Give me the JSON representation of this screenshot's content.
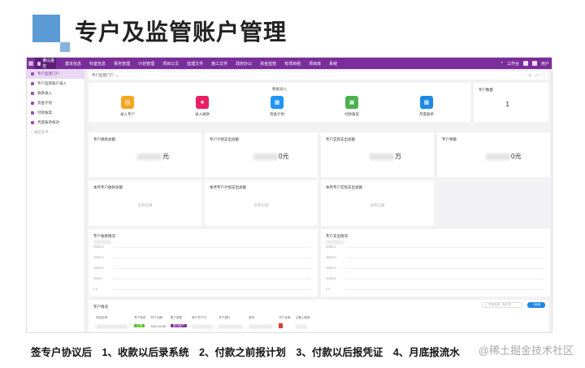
{
  "slide": {
    "title": "专户及监管账户管理",
    "caption": "签专户协议后　1、收款以后录系统　2、付款之前报计划　3、付款以后报凭证　4、月底报流水",
    "watermark": "@稀土掘金技术社区"
  },
  "app": {
    "logo_text": "佛山金控",
    "nav": [
      "基本信息",
      "科室信息",
      "事务管理",
      "计划管理",
      "项目公文",
      "监理文件",
      "施工文件",
      "政府办公",
      "资金监管",
      "有项目组",
      "项目库",
      "系统"
    ],
    "nav_right": {
      "workbench": "工作台",
      "user": "用户"
    },
    "sidebar": [
      {
        "label": "专户监管门户",
        "active": true
      },
      {
        "label": "专户监管账户录入",
        "active": false
      },
      {
        "label": "收款录入",
        "active": false
      },
      {
        "label": "资金计划",
        "active": false
      },
      {
        "label": "付款备案",
        "active": false
      },
      {
        "label": "月度账单核对",
        "active": false
      }
    ],
    "sidebar_collapse": "« 收起菜单",
    "tab": {
      "label": "专户监管门户",
      "close": "×"
    },
    "quick": {
      "caption": "数据录入",
      "items": [
        {
          "label": "录入专户",
          "icon": "book-icon",
          "color": "#f5a623",
          "glyph": "▤"
        },
        {
          "label": "录入收款",
          "icon": "star-icon",
          "color": "#e91e63",
          "glyph": "★"
        },
        {
          "label": "资金计划",
          "icon": "doc-icon",
          "color": "#2196f3",
          "glyph": "▦"
        },
        {
          "label": "付款备案",
          "icon": "image-icon",
          "color": "#4caf50",
          "glyph": "▣"
        },
        {
          "label": "月度账单",
          "icon": "calendar-icon",
          "color": "#1e88e5",
          "glyph": "▦"
        }
      ]
    },
    "account_count": {
      "title": "专户数量",
      "value": "1"
    },
    "stats": [
      {
        "title": "专户收款总额",
        "suffix": "元"
      },
      {
        "title": "专户计划支出总额",
        "suffix": "0元"
      },
      {
        "title": "专户实际支出总额",
        "suffix": "万"
      },
      {
        "title": "专户余额",
        "suffix": "0元"
      }
    ],
    "monthly": [
      {
        "title": "本月专户收款总额",
        "empty": "没有记录"
      },
      {
        "title": "本月专户计划支出总额",
        "empty": "没有记录"
      },
      {
        "title": "本月专户实际支出总额",
        "empty": "没有记录"
      }
    ],
    "charts": [
      {
        "title": "专户收款情况",
        "ticks": [
          "20000.0",
          "15000.0",
          "10000.0",
          "5000.0",
          "0.0"
        ]
      },
      {
        "title": "专户支出情况",
        "ticks": [
          "40000.0",
          "30000.0",
          "20000.0",
          "10000.0",
          "0.0"
        ]
      }
    ],
    "table": {
      "title": "专户情况",
      "search_placeholder": "项目名称、账户名",
      "add_label": "+ 新增",
      "headers": [
        "项目名称",
        "专户状态",
        "开户日期",
        "账户类型",
        "账户开户行",
        "开户银行",
        "账号",
        "开户证明",
        "主管工程师"
      ],
      "row": {
        "status": "正常",
        "date": "2022-04-08",
        "type": "银行账户"
      }
    }
  }
}
